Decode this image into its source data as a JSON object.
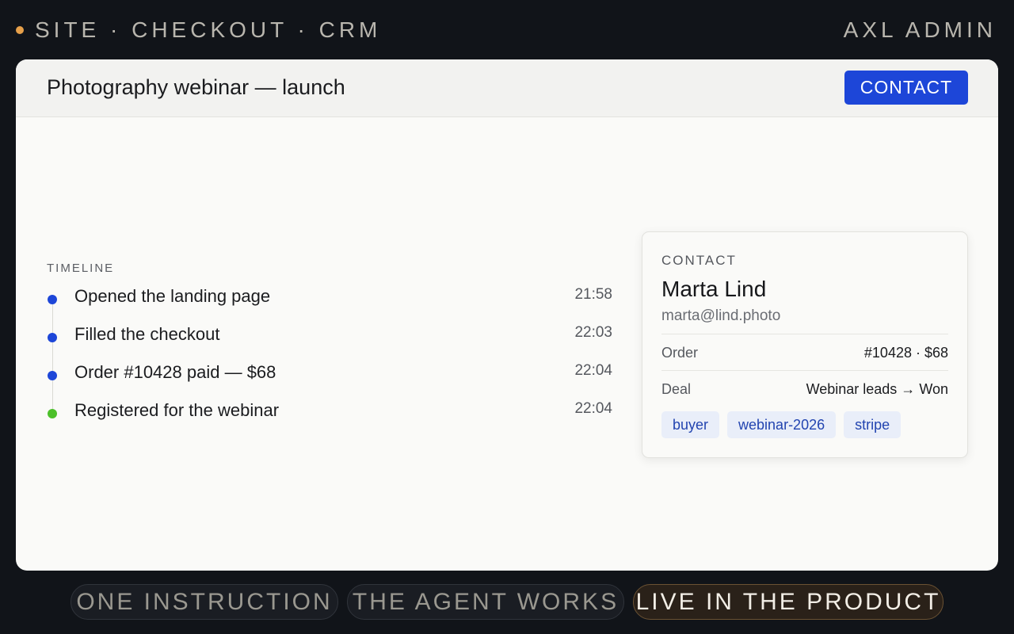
{
  "topbar": {
    "brand": "SITE · CHECKOUT · CRM",
    "admin": "AXL ADMIN",
    "accent_color": "#e6a04a"
  },
  "card": {
    "title": "Photography webinar — launch",
    "contact_button": "CONTACT"
  },
  "timeline": {
    "label": "TIMELINE",
    "items": [
      {
        "text": "Opened the landing page",
        "time": "21:58",
        "color": "#1d46d8"
      },
      {
        "text": "Filled the checkout",
        "time": "22:03",
        "color": "#1d46d8"
      },
      {
        "text": "Order #10428 paid — $68",
        "time": "22:04",
        "color": "#1d46d8"
      },
      {
        "text": "Registered for the webinar",
        "time": "22:04",
        "color": "#4cc02a"
      }
    ]
  },
  "contact": {
    "label": "CONTACT",
    "name": "Marta Lind",
    "email": "marta@lind.photo",
    "order_label": "Order",
    "order_value": "#10428 · $68",
    "deal_label": "Deal",
    "deal_value": "Webinar leads → Won",
    "tags": [
      "buyer",
      "webinar-2026",
      "stripe"
    ]
  },
  "steps": [
    "ONE INSTRUCTION",
    "THE AGENT WORKS",
    "LIVE IN THE PRODUCT"
  ]
}
